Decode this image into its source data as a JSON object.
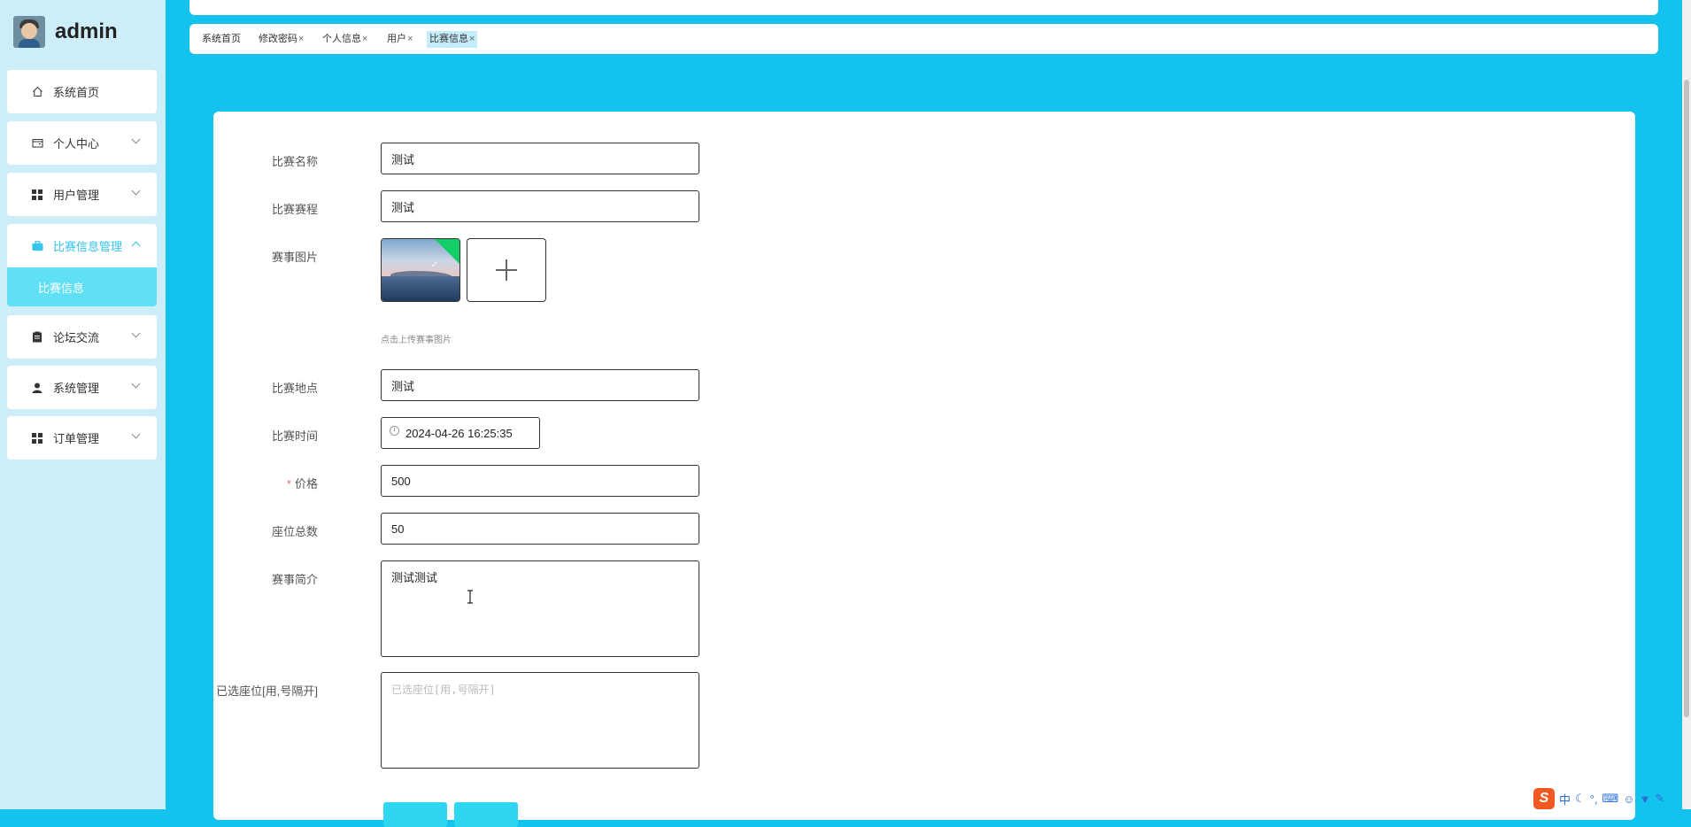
{
  "brand": {
    "name": "admin"
  },
  "sidebar": {
    "items": [
      {
        "label": "系统首页",
        "icon": "home-icon"
      },
      {
        "label": "个人中心",
        "icon": "wallet-icon"
      },
      {
        "label": "用户管理",
        "icon": "grid-icon"
      },
      {
        "label": "比赛信息管理",
        "icon": "briefcase-icon"
      },
      {
        "label": "论坛交流",
        "icon": "clipboard-icon"
      },
      {
        "label": "系统管理",
        "icon": "user-icon"
      },
      {
        "label": "订单管理",
        "icon": "grid-icon"
      }
    ],
    "submenu": {
      "label": "比赛信息"
    }
  },
  "tabs": [
    {
      "label": "系统首页",
      "closable": false
    },
    {
      "label": "修改密码",
      "closable": true
    },
    {
      "label": "个人信息",
      "closable": true
    },
    {
      "label": "用户",
      "closable": true
    },
    {
      "label": "比赛信息",
      "closable": true,
      "active": true
    }
  ],
  "form": {
    "name": {
      "label": "比赛名称",
      "value": "测试"
    },
    "schedule": {
      "label": "比赛赛程",
      "value": "测试"
    },
    "image": {
      "label": "赛事图片",
      "tip": "点击上传赛事图片"
    },
    "location": {
      "label": "比赛地点",
      "value": "测试"
    },
    "time": {
      "label": "比赛时间",
      "value": "2024-04-26 16:25:35"
    },
    "price": {
      "label": "价格",
      "value": "500",
      "required": true
    },
    "seats": {
      "label": "座位总数",
      "value": "50"
    },
    "intro": {
      "label": "赛事简介",
      "value": "测试测试"
    },
    "selected_seats": {
      "label": "已选座位[用,号隔开]",
      "placeholder": "已选座位[用,号隔开]"
    }
  },
  "tray": {
    "ime_logo": "S",
    "ime_mode": "中",
    "items": [
      "moon-icon",
      "degree-icon",
      "keyboard-icon",
      "person-icon",
      "shirt-icon",
      "wrench-icon"
    ]
  },
  "colors": {
    "accent": "#13c2ed",
    "sidebar_bg": "#cdeef8",
    "submenu_bg": "#5fe0f5",
    "required": "#f56c6c"
  }
}
